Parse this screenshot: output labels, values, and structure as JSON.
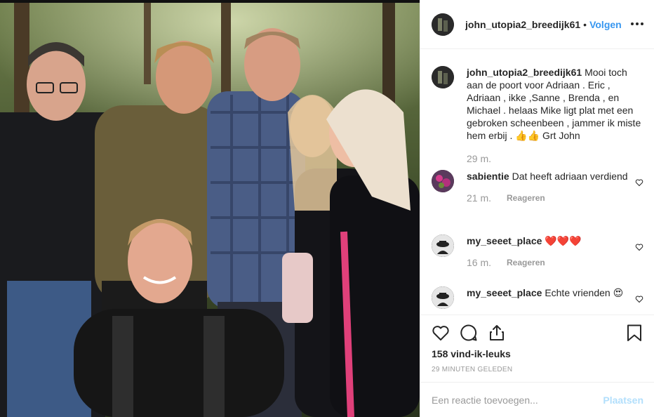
{
  "header": {
    "username": "john_utopia2_breedijk61",
    "follow_label": "Volgen"
  },
  "caption": {
    "username": "john_utopia2_breedijk61",
    "text": "Mooi toch aan de poort voor Adriaan . Eric , Adriaan , ikke ,Sanne , Brenda , en Michael . helaas Mike ligt plat met een gebroken scheenbeen , jammer ik miste hem erbij . 👍👍 Grt John",
    "time": "29 m."
  },
  "comments": [
    {
      "username": "sabientie",
      "text": "Dat heeft adriaan verdiend",
      "time": "21 m.",
      "reply_label": "Reageren"
    },
    {
      "username": "my_seeet_place",
      "text": "❤️❤️❤️",
      "time": "16 m.",
      "reply_label": "Reageren"
    },
    {
      "username": "my_seeet_place",
      "text": "Echte vrienden 😍"
    }
  ],
  "actions": {
    "likes": "158 vind-ik-leuks",
    "timeago": "29 MINUTEN GELEDEN"
  },
  "add_comment": {
    "placeholder": "Een reactie toevoegen...",
    "post_label": "Plaatsen"
  },
  "icons": {
    "like": "heart-icon",
    "comment": "comment-icon",
    "share": "share-icon",
    "save": "bookmark-icon",
    "more": "more-options-icon"
  },
  "colors": {
    "accent": "#3897f0",
    "post_button_disabled": "#b2dffc",
    "muted_text": "#999999"
  }
}
